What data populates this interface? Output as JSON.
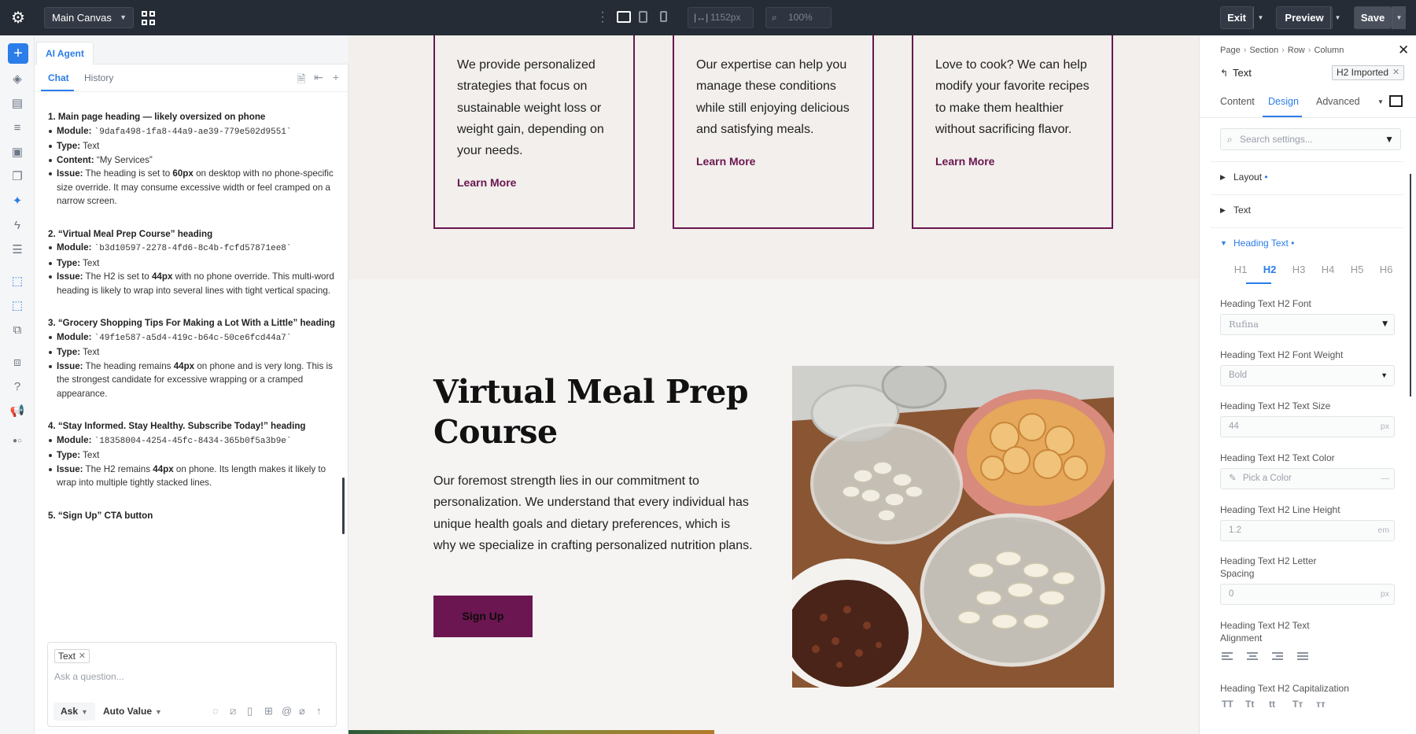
{
  "topbar": {
    "canvas_name": "Main Canvas",
    "width_value": "1152px",
    "zoom_value": "100%",
    "exit_label": "Exit",
    "preview_label": "Preview",
    "save_label": "Save"
  },
  "agent": {
    "tab_label": "AI Agent",
    "subtabs": [
      "Chat",
      "History"
    ],
    "issues": [
      {
        "title": "1. Main page heading — likely oversized on phone",
        "module_label": "Module:",
        "module_value": "`9dafa498-1fa8-44a9-ae39-779e502d9551`",
        "type_label": "Type:",
        "type_value": "Text",
        "content_label": "Content:",
        "content_value": "“My Services”",
        "issue_label": "Issue:",
        "issue_pre": "The heading is set to",
        "issue_bold": "60px",
        "issue_post": "on desktop with no phone-specific size override. It may consume excessive width or feel cramped on a narrow screen."
      },
      {
        "title": "2. “Virtual Meal Prep Course” heading",
        "module_label": "Module:",
        "module_value": "`b3d10597-2278-4fd6-8c4b-fcfd57871ee8`",
        "type_label": "Type:",
        "type_value": "Text",
        "issue_label": "Issue:",
        "issue_pre": "The H2 is set to",
        "issue_bold": "44px",
        "issue_post": "with no phone override. This multi-word heading is likely to wrap into several lines with tight vertical spacing."
      },
      {
        "title": "3. “Grocery Shopping Tips For Making a Lot With a Little” heading",
        "module_label": "Module:",
        "module_value": "`49f1e587-a5d4-419c-b64c-50ce6fcd44a7`",
        "type_label": "Type:",
        "type_value": "Text",
        "issue_label": "Issue:",
        "issue_pre": "The heading remains",
        "issue_bold": "44px",
        "issue_post": "on phone and is very long. This is the strongest candidate for excessive wrapping or a cramped appearance."
      },
      {
        "title": "4. “Stay Informed. Stay Healthy. Subscribe Today!” heading",
        "module_label": "Module:",
        "module_value": "`18358004-4254-45fc-8434-365b0f5a3b9e`",
        "type_label": "Type:",
        "type_value": "Text",
        "issue_label": "Issue:",
        "issue_pre": "The H2 remains",
        "issue_bold": "44px",
        "issue_post": "on phone. Its length makes it likely to wrap into multiple tightly stacked lines."
      },
      {
        "title": "5. “Sign Up” CTA button"
      }
    ],
    "composer": {
      "chip": "Text",
      "placeholder": "Ask a question...",
      "mode": "Ask",
      "value_mode": "Auto Value"
    }
  },
  "canvas": {
    "cards": [
      {
        "text": "We provide personalized strategies that focus on sustainable weight loss or weight gain, depending on your needs.",
        "link": "Learn More"
      },
      {
        "text": "Our expertise can help you manage these conditions while still enjoying delicious and satisfying meals.",
        "link": "Learn More"
      },
      {
        "text": "Love to cook? We can help modify your favorite recipes to make them healthier without sacrificing flavor.",
        "link": "Learn More"
      }
    ],
    "heading": "Virtual Meal Prep Course",
    "body": "Our foremost strength lies in our commitment to personalization. We understand that every individual has unique health goals and dietary preferences, which is why we specialize in crafting personalized nutrition plans.",
    "button": "Sign Up",
    "accent": "#6b1650"
  },
  "settings": {
    "breadcrumb": [
      "Page",
      "Section",
      "Row",
      "Column"
    ],
    "element_name": "Text",
    "preset_badge": "H2 Imported",
    "tabs": [
      "Content",
      "Design",
      "Advanced"
    ],
    "search_placeholder": "Search settings...",
    "sections": [
      "Layout",
      "Text",
      "Heading Text"
    ],
    "heading_levels": [
      "H1",
      "H2",
      "H3",
      "H4",
      "H5",
      "H6"
    ],
    "fields": {
      "font_label": "Heading Text H2 Font",
      "font_value": "Rufina",
      "weight_label": "Heading Text H2 Font Weight",
      "weight_value": "Bold",
      "size_label": "Heading Text H2 Text Size",
      "size_value": "44",
      "size_unit": "px",
      "color_label": "Heading Text H2 Text Color",
      "color_placeholder": "Pick a Color",
      "lineheight_label": "Heading Text H2 Line Height",
      "lineheight_value": "1.2",
      "lineheight_unit": "em",
      "spacing_label": "Heading Text H2 Letter Spacing",
      "spacing_value": "0",
      "spacing_unit": "px",
      "alignment_label": "Heading Text H2 Text Alignment",
      "capitalization_label": "Heading Text H2 Capitalization",
      "capitalization_options": [
        "TT",
        "Tt",
        "tt",
        "Tт",
        "тт"
      ]
    },
    "accent": "#2b7de9"
  }
}
